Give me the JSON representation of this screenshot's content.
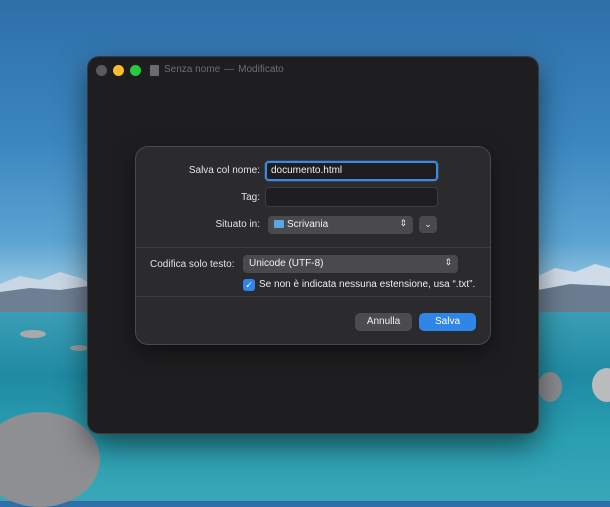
{
  "window": {
    "title": "Senza nome",
    "separator": "—",
    "status": "Modificato"
  },
  "dialog": {
    "save_as_label": "Salva col nome:",
    "filename_value": "documento.html",
    "tags_label": "Tag:",
    "tags_value": "",
    "location_label": "Situato in:",
    "location_value": "Scrivania",
    "encoding_label": "Codifica solo testo:",
    "encoding_value": "Unicode (UTF-8)",
    "extension_checkbox_label": "Se non è indicata nessuna estensione, usa “.txt”.",
    "extension_checked": true,
    "cancel_label": "Annulla",
    "save_label": "Salva"
  },
  "icons": {
    "document": "document-icon",
    "folder": "folder-icon",
    "chevron_updown": "chevron-updown-icon",
    "chevron_down": "chevron-down-icon",
    "checkmark": "checkmark-icon"
  },
  "colors": {
    "accent": "#2f86e8",
    "close": "#5a5a5c",
    "minimize": "#febc2e",
    "maximize": "#28c840"
  }
}
